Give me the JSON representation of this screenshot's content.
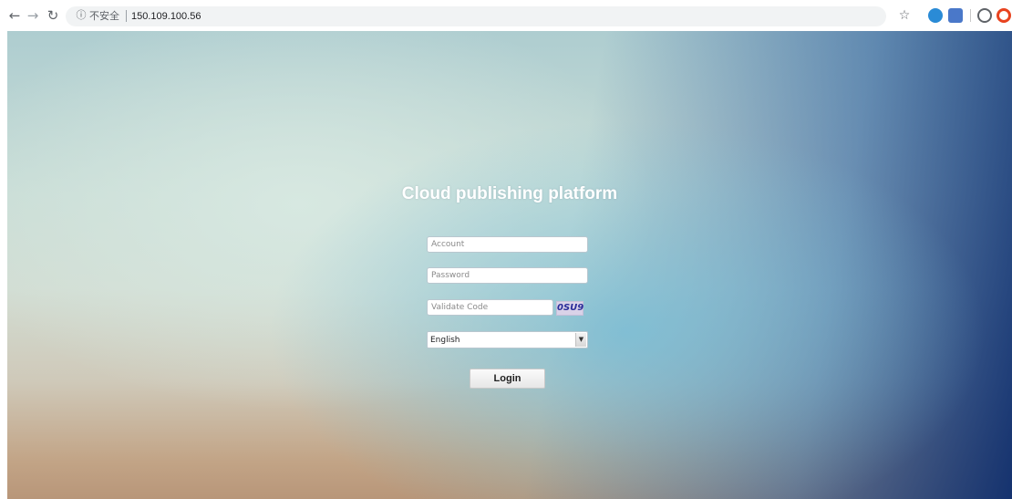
{
  "browser": {
    "back_icon": "arrow-left-icon",
    "forward_icon": "arrow-right-icon",
    "reload_icon": "reload-icon",
    "info_icon": "info-icon",
    "security_label": "不安全",
    "url": "150.109.100.56",
    "bookmark_icon": "star-icon",
    "extensions": [
      {
        "name": "blue-extension-icon",
        "color": "#2a8bd6"
      },
      {
        "name": "book-extension-icon",
        "color": "#4a78c9"
      },
      {
        "name": "account-icon",
        "color": "#5f6368"
      },
      {
        "name": "red-extension-icon",
        "color": "#e8431f"
      }
    ]
  },
  "login": {
    "title": "Cloud publishing platform",
    "account_placeholder": "Account",
    "password_placeholder": "Password",
    "validate_placeholder": "Validate Code",
    "captcha_text": "0SU9",
    "language": "English",
    "login_label": "Login"
  },
  "colors": {
    "title_text": "#ffffff",
    "background_accent": "#0c2d6e"
  }
}
